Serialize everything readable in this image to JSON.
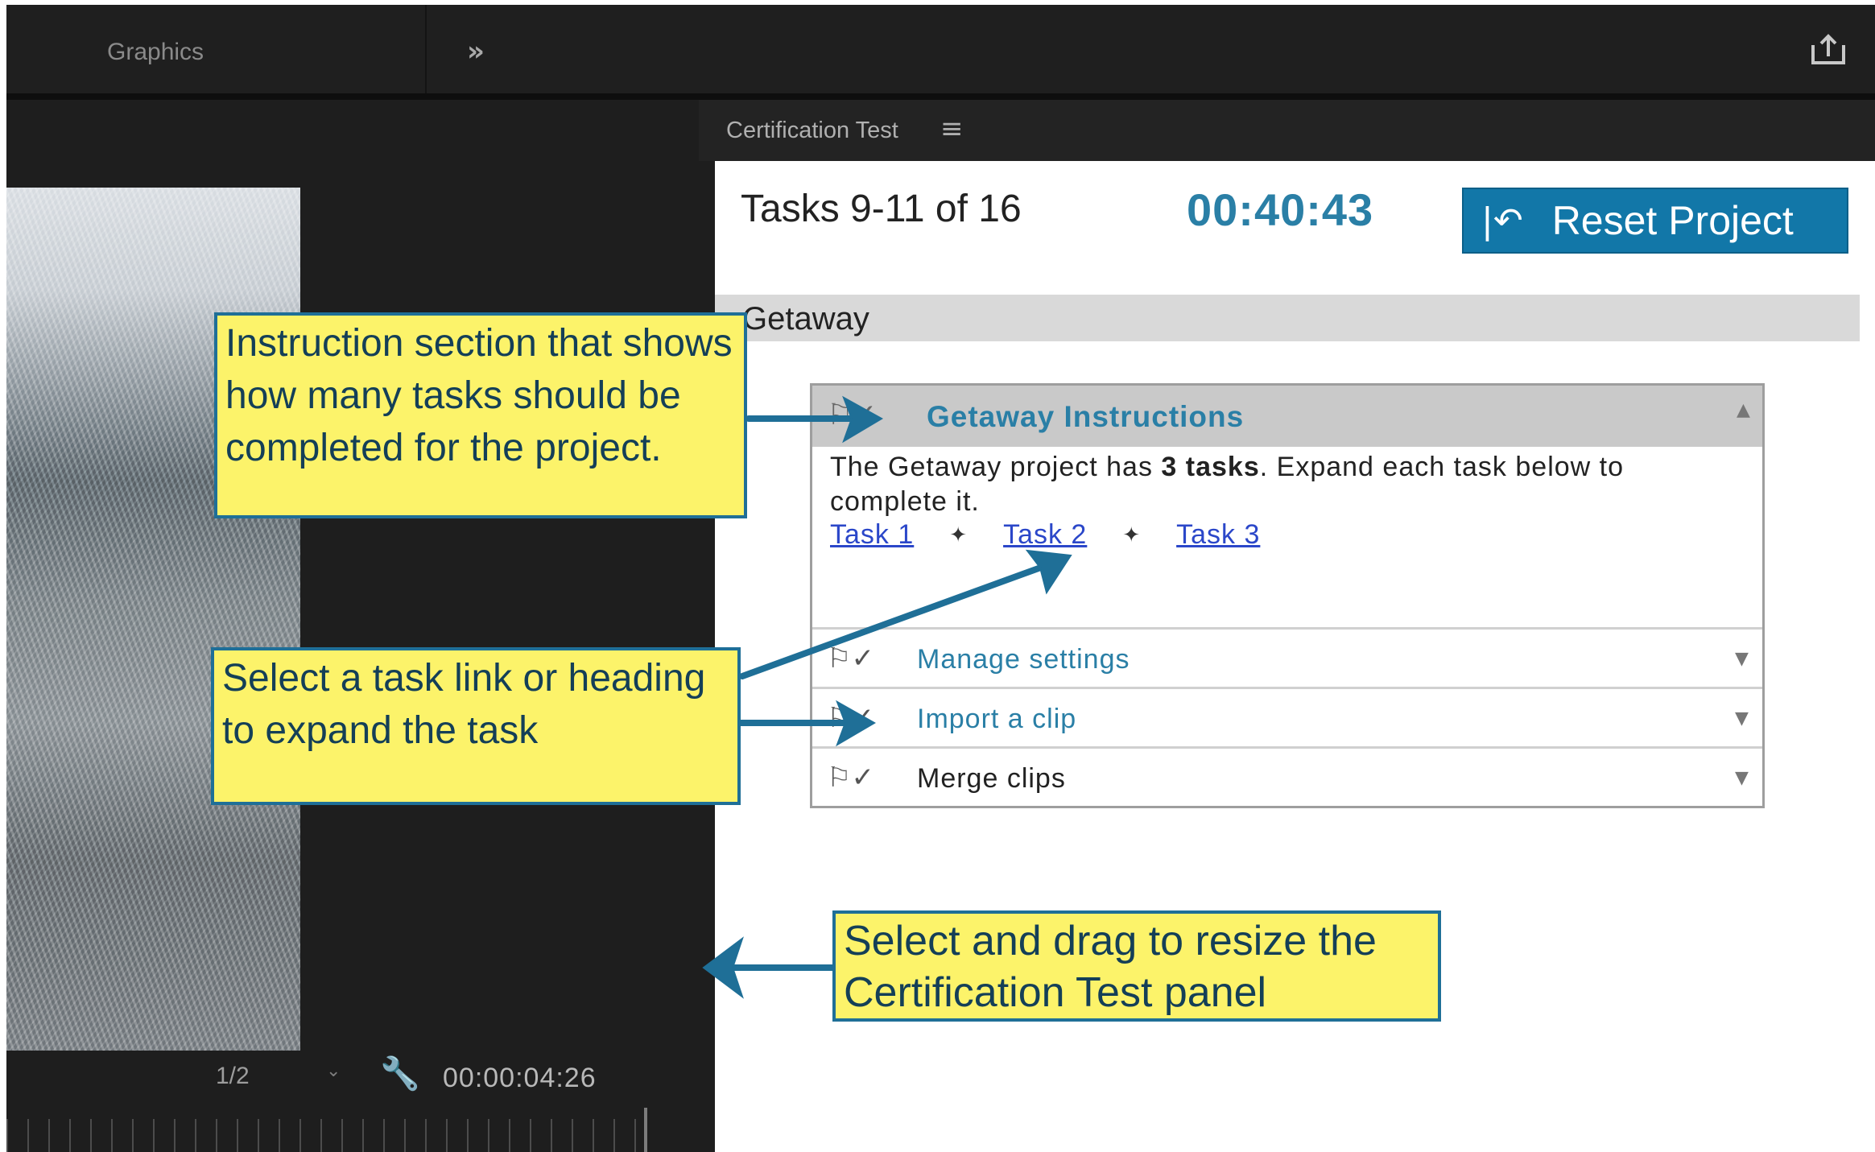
{
  "top_bar": {
    "workspace_label": "Graphics",
    "overflow_glyph": "»",
    "share_icon": "share-icon"
  },
  "monitor": {
    "zoom_value": "1/2",
    "timecode": "00:00:04:26"
  },
  "panel": {
    "title": "Certification Test",
    "menu_glyph": "≡",
    "tasks_count": "Tasks 9-11 of 16",
    "timer": "00:40:43",
    "reset_label": "Reset Project",
    "project_name": "Getaway",
    "instructions": {
      "title": "Getaway Instructions",
      "body_prefix": "The Getaway project has ",
      "body_bold": "3 tasks",
      "body_suffix": ". Expand each task below to complete it.",
      "links": [
        "Task 1",
        "Task 2",
        "Task 3"
      ]
    },
    "tasks": [
      {
        "title": "Manage settings",
        "color": "#2a7fa6"
      },
      {
        "title": "Import a clip",
        "color": "#2a7fa6"
      },
      {
        "title": "Merge clips",
        "color": "#222222"
      }
    ]
  },
  "callouts": [
    "Instruction section that shows how many tasks should be completed for the project.",
    "Select a task link or heading to expand the task",
    "Select and drag to resize the Certification Test panel"
  ],
  "colors": {
    "accent": "#2a7fa6",
    "reset_button": "#1277a8",
    "callout_fill": "#fcf36a",
    "callout_border": "#1f6f97",
    "arrow": "#1f6f97"
  }
}
